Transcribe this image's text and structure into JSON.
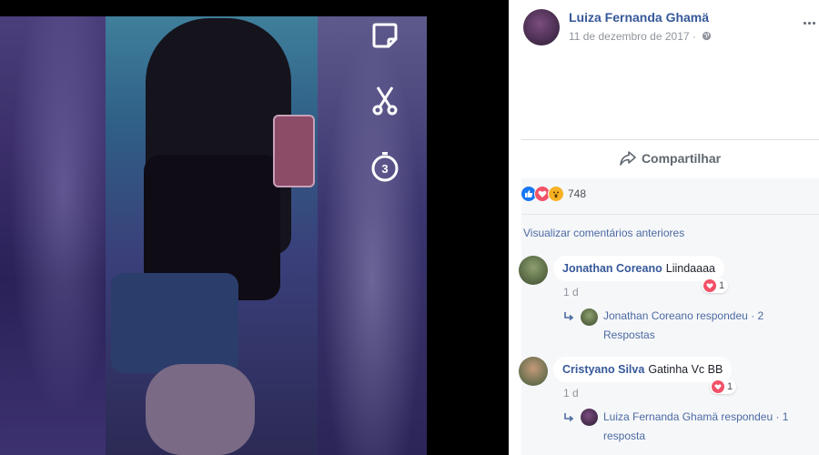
{
  "post": {
    "author": "Luiza Fernanda Ghamä",
    "date": "11 de dezembro de 2017 ·",
    "share_label": "Compartilhar",
    "reaction_count": "748",
    "view_previous": "Visualizar comentários anteriores"
  },
  "comments": [
    {
      "author": "Jonathan Coreano",
      "text": "Liindaaaa",
      "time": "1 d",
      "likes": "1",
      "reply_summary": "Jonathan Coreano respondeu · 2 Respostas"
    },
    {
      "author": "Cristyano Silva",
      "text": "Gatinha Vc BB",
      "time": "1 d",
      "likes": "1",
      "reply_summary": "Luiza Fernanda Ghamä respondeu · 1 resposta"
    }
  ],
  "snap": {
    "timer_value": "3"
  },
  "icons": [
    "sticker-icon",
    "scissors-icon",
    "timer-icon",
    "globe-icon",
    "more-options-icon",
    "share-icon",
    "like-reaction-icon",
    "love-reaction-icon",
    "wow-reaction-icon",
    "reply-arrow-icon",
    "heart-icon"
  ],
  "colors": {
    "link": "#365899",
    "meta": "#90949c",
    "love": "#f25268",
    "like": "#1877f2",
    "wow": "#f7b125"
  }
}
